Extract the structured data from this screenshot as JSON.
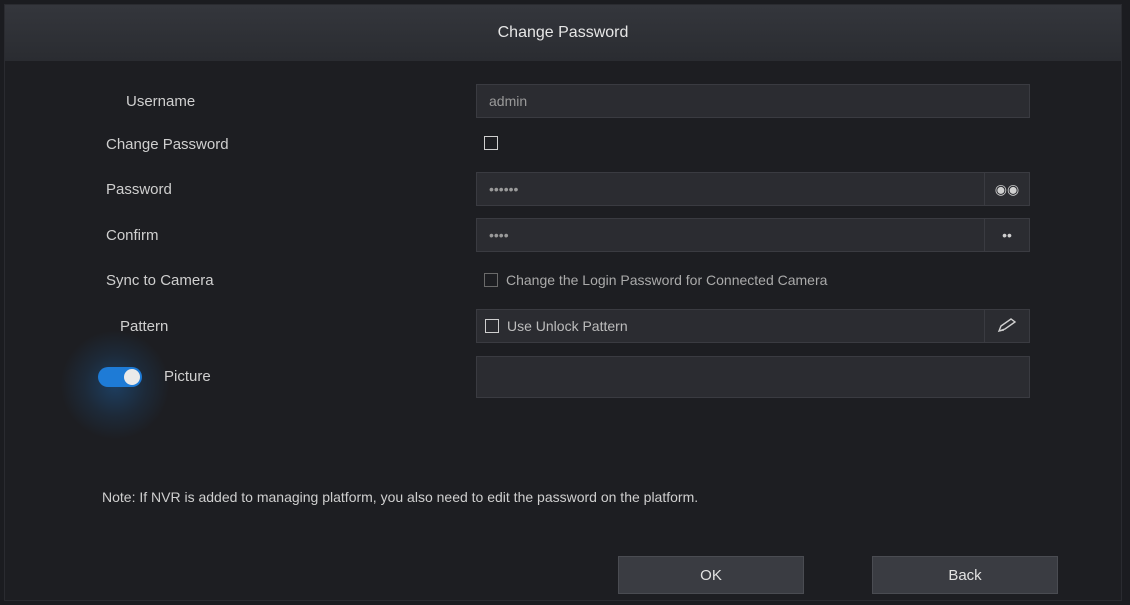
{
  "dialog": {
    "title": "Change Password"
  },
  "form": {
    "username_label": "Username",
    "username_value": "admin",
    "change_password_label": "Change Password",
    "password_label": "Password",
    "password_value": "••••••",
    "password_eye": "◉◉",
    "confirm_label": "Confirm",
    "confirm_value": "••••",
    "confirm_eye": "••",
    "sync_label": "Sync to Camera",
    "sync_option": "Change the Login Password for Connected Camera",
    "pattern_label": "Pattern",
    "pattern_option": "Use Unlock Pattern",
    "pattern_icon": "pencil-icon",
    "toggle_label": "Picture"
  },
  "note": {
    "text": "Note: If NVR is added to managing platform, you also need to edit the password on the platform."
  },
  "buttons": {
    "ok": "OK",
    "back": "Back"
  },
  "colors": {
    "accent": "#1e7bd6",
    "background": "#1d1e22",
    "field": "#2b2c31"
  }
}
